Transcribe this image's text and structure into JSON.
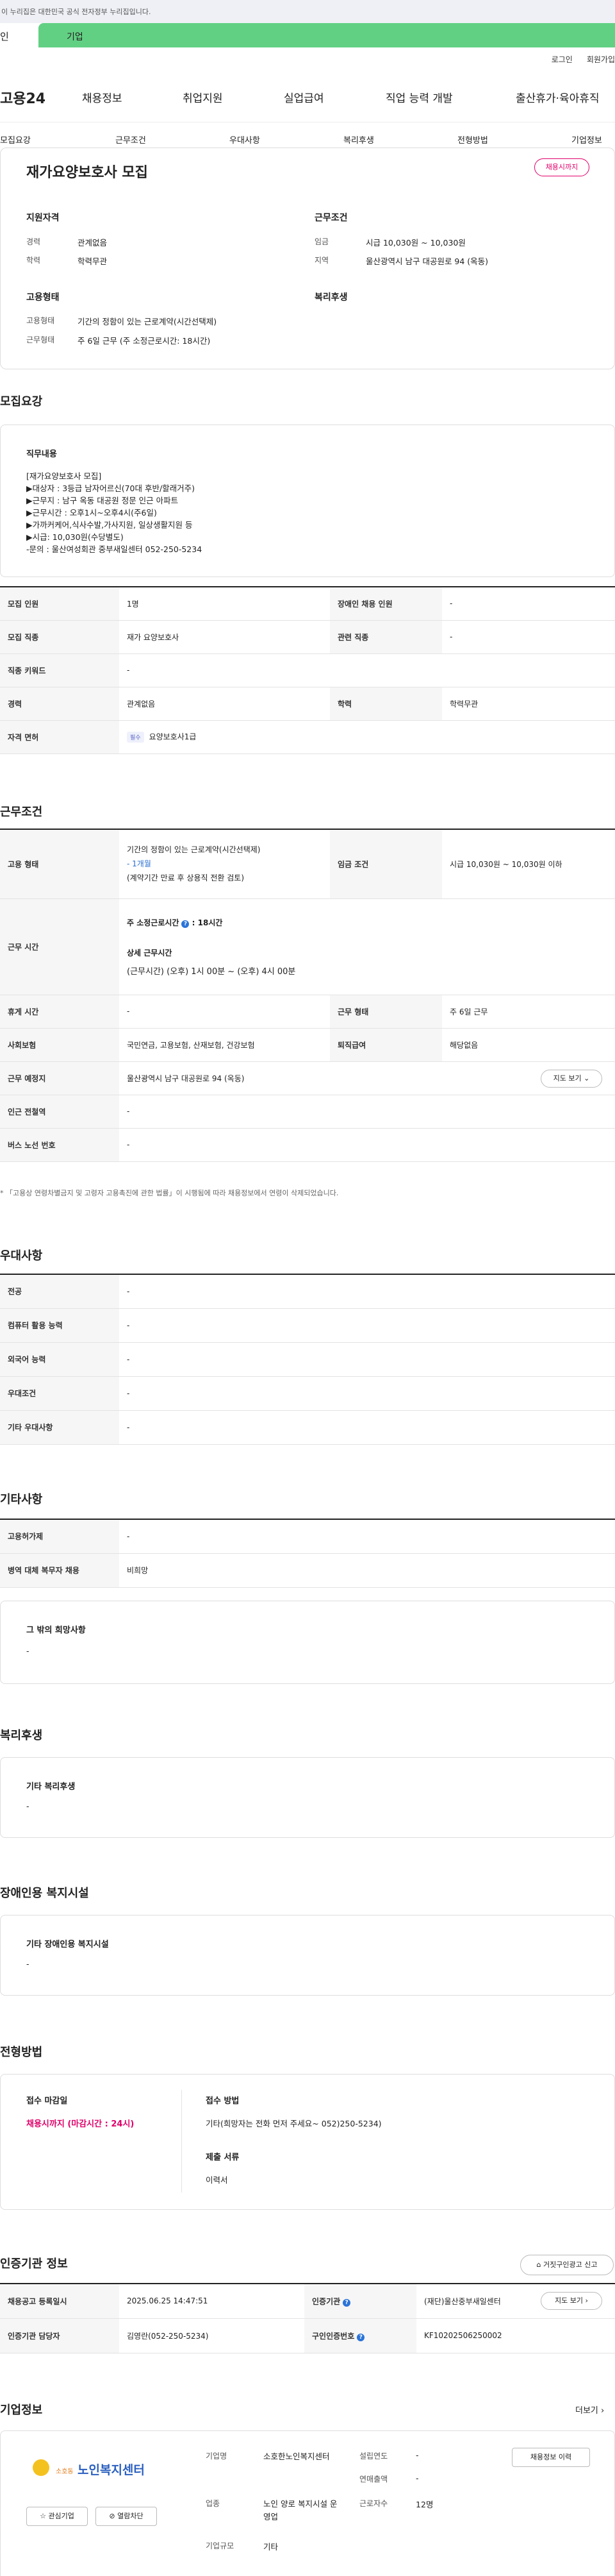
{
  "gov_banner": "이 누리집은 대한민국 공식 전자정부 누리집입니다.",
  "top_tabs": {
    "personal": "인",
    "company": "기업"
  },
  "util": {
    "login": "로그인",
    "signup": "회원가입"
  },
  "logo": "고용24",
  "gnb": [
    "채용정보",
    "취업지원",
    "실업급여",
    "직업 능력 개발",
    "출산휴가·육아휴직"
  ],
  "subnav": [
    "모집요강",
    "근무조건",
    "우대사항",
    "복리후생",
    "전형방법",
    "기업정보"
  ],
  "job": {
    "title": "재가요양보호사 모집",
    "badge": "채용시까지",
    "qual_title": "지원자격",
    "career_label": "경력",
    "career": "관계없음",
    "edu_label": "학력",
    "edu": "학력무관",
    "cond_title": "근무조건",
    "wage_label": "임금",
    "wage": "시급 10,030원 ~ 10,030원",
    "area_label": "지역",
    "area": "울산광역시 남구 대공원로 94 (옥동)",
    "emp_title": "고용형태",
    "emptype_label": "고용형태",
    "emptype": "기간의 정함이 있는 근로계약(시간선택제)",
    "worktype_label": "근무형태",
    "worktype": "주 6일 근무 (주 소정근로시간: 18시간)",
    "welfare_title": "복리후생"
  },
  "recruit": {
    "title": "모집요강",
    "duty_title": "직무내용",
    "duty_lines": [
      "[재가요양보호사 모집]",
      "▶대상자 : 3등급 남자어르신(70대 후반/할래거주)",
      "▶근무지 : 남구 옥동 대공원 정문 인근 아파트",
      "▶근무시간 : 오후1시~오후4시(주6일)",
      "▶가까커케어,식사수발,가사지원, 일상생활지원 등",
      "▶시급: 10,030원(수당별도)",
      "-문의 : 울산여성회관 중부새일센터 052-250-5234"
    ],
    "rows": [
      {
        "l1": "모집 인원",
        "v1": "1명",
        "l2": "장애인 채용 인원",
        "v2": "-"
      },
      {
        "l1": "모집 직종",
        "v1": "재가 요양보호사",
        "l2": "관련 직종",
        "v2": "-"
      },
      {
        "l1": "직종 키워드",
        "v1": "-"
      },
      {
        "l1": "경력",
        "v1": "관계없음",
        "l2": "학력",
        "v2": "학력무관"
      },
      {
        "l1": "자격 면허",
        "chk": "필수",
        "v1": "요양보호사1급"
      }
    ]
  },
  "conditions": {
    "title": "근무조건",
    "emp_label": "고용 형태",
    "emp_line1": "기간의 정함이 있는 근로계약(시간선택제)",
    "emp_line2": "- 1개월",
    "emp_line3": "(계약기간 만료 후 상용직 전환 검토)",
    "wage_label": "임금 조건",
    "wage": "시급 10,030원 ~ 10,030원 이하",
    "hours_label": "근무 시간",
    "hours_head": "주 소정근로시간",
    "hours_val": ": 18시간",
    "detail_head": "상세 근무시간",
    "detail_val": "(근무시간) (오후) 1시 00분 ~ (오후) 4시 00분",
    "break_label": "휴게 시간",
    "break": "-",
    "days_label": "근무 형태",
    "days": "주 6일 근무",
    "ins_label": "사회보험",
    "ins": "국민연금, 고용보험, 산재보험, 건강보험",
    "sev_label": "퇴직급여",
    "sev": "해당없음",
    "place_label": "근무 예정지",
    "place": "울산광역시 남구 대공원로 94 (옥동)",
    "map_btn": "지도 보기",
    "near_label": "인근 전철역",
    "near": "-",
    "bus_label": "버스 노선 번호",
    "bus": "-",
    "note": "* 「고용상 연령차별금지 및 고령자 고용촉진에 관한 법률」이 시행됨에 따라 채용정보에서 연령이 삭제되었습니다."
  },
  "pref": {
    "title": "우대사항",
    "rows": [
      {
        "l": "전공",
        "v": "-"
      },
      {
        "l": "컴퓨터 활용 능력",
        "v": "-"
      },
      {
        "l": "외국어 능력",
        "v": "-"
      },
      {
        "l": "우대조건",
        "v": "-"
      },
      {
        "l": "기타 우대사항",
        "v": "-"
      }
    ]
  },
  "etc": {
    "title": "기타사항",
    "rows": [
      {
        "l": "고용허가제",
        "v": "-"
      },
      {
        "l": "병역 대체 복무자 채용",
        "v": "비희망"
      }
    ],
    "other_title": "그 밖의 희망사항",
    "other_val": "-"
  },
  "welfare": {
    "title": "복리후생",
    "box_title": "기타 복리후생",
    "box_val": "-"
  },
  "disabled": {
    "title": "장애인용 복지시설",
    "box_title": "기타 장애인용 복지시설",
    "box_val": "-"
  },
  "selection": {
    "title": "전형방법",
    "deadline_title": "접수 마감일",
    "deadline": "채용시까지 (마감시간 : 24시)",
    "method_title": "접수 방법",
    "method": "기타(희망자는 전화 먼저 주세요~ 052)250-5234)",
    "docs_title": "제출 서류",
    "docs": "이력서"
  },
  "agency": {
    "title": "인증기관 정보",
    "report_btn": "거짓구인광고 신고",
    "reg_label": "채용공고 등록일시",
    "reg": "2025.06.25 14:47:51",
    "org_label": "인증기관",
    "org": "(재단)울산중부새일센터",
    "map_btn": "지도 보기",
    "mgr_label": "인증기관 담당자",
    "mgr": "김영란(052-250-5234)",
    "no_label": "구인인증번호",
    "no": "KF10202506250002"
  },
  "company": {
    "title": "기업정보",
    "more": "더보기",
    "logo_sub": "소호동",
    "logo_name": "노인복지센터",
    "fav_btn": "관심기업",
    "block_btn": "열람차단",
    "jobinfo_btn": "채용정보 이력",
    "name_label": "기업명",
    "name": "소호한노인복지센터",
    "founded_label": "설립연도",
    "founded": "-",
    "sales_label": "연매출액",
    "sales": "-",
    "industry_label": "업종",
    "industry": "노인 양로 복지시설 운영업",
    "emp_label": "근로자수",
    "emp": "12명",
    "size_label": "기업규모",
    "size": "기타"
  }
}
